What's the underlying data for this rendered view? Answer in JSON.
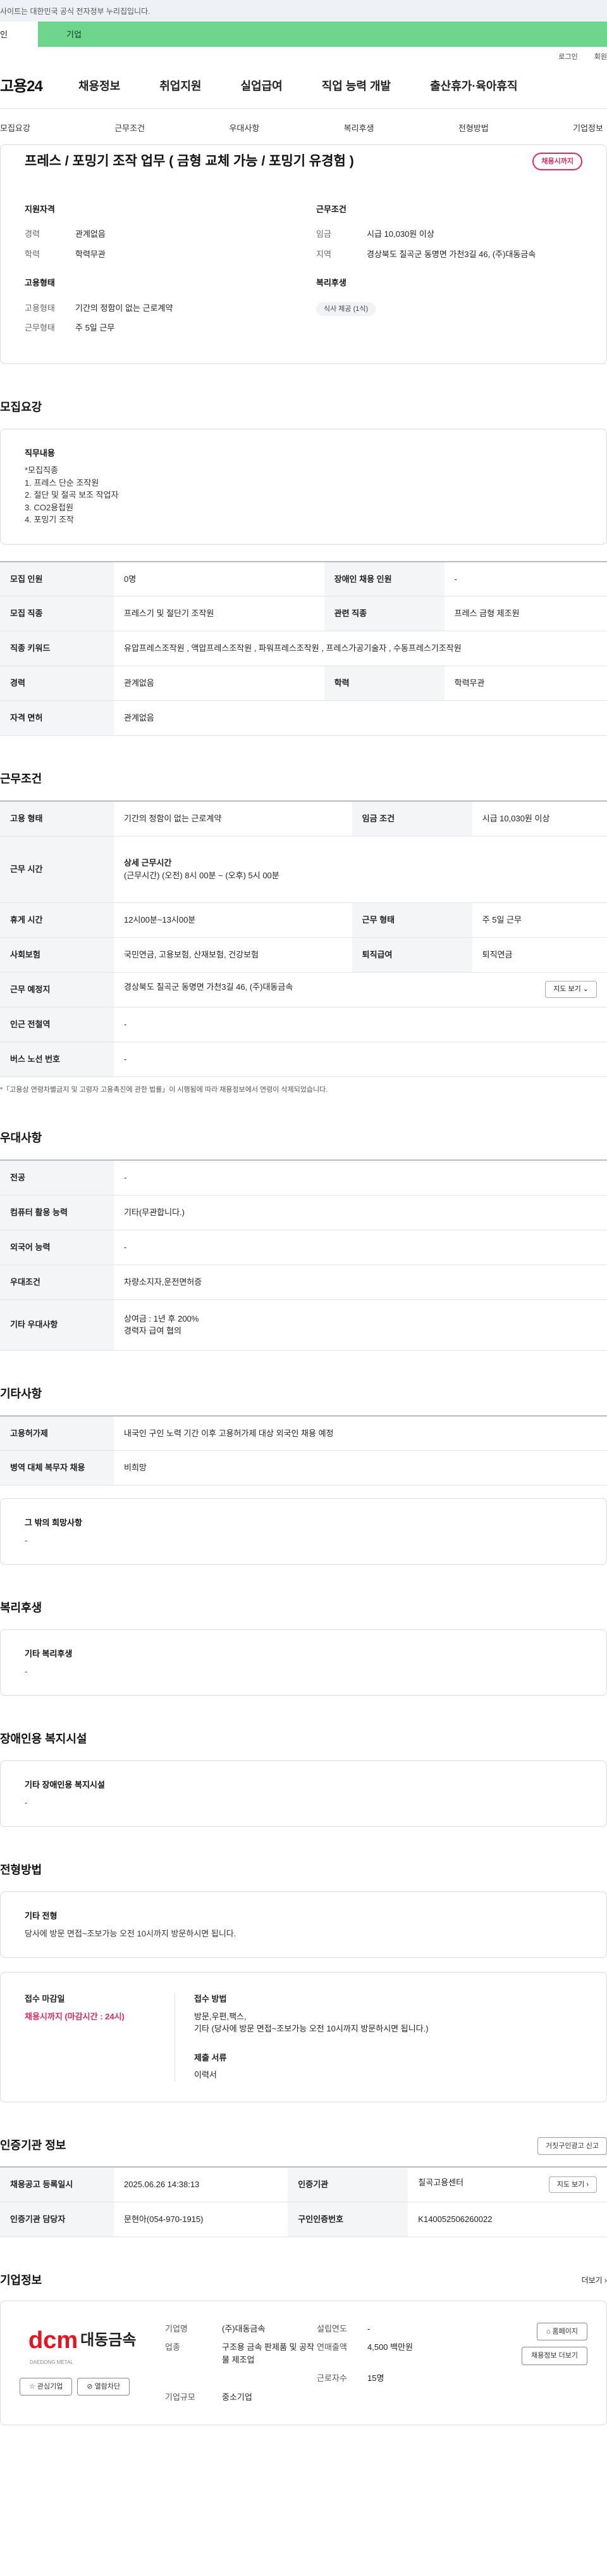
{
  "topbar": {
    "notice": "사이트는 대한민국 공식 전자정부 누리집입니다."
  },
  "tabs": {
    "tab1": "인",
    "tab2": "기업"
  },
  "util": {
    "login": "로그인",
    "join": "회원"
  },
  "gnb": {
    "logo": "고용24",
    "items": [
      "채용정보",
      "취업지원",
      "실업급여",
      "직업 능력 개발",
      "출산휴가·육아휴직"
    ]
  },
  "subnav": [
    "모집요강",
    "근무조건",
    "우대사항",
    "복리후생",
    "전형방법",
    "기업정보"
  ],
  "summary": {
    "title": "프레스 / 포밍기 조작 업무 ( 금형 교체 가능 / 포밍기 유경험 )",
    "badge": "채용시까지",
    "qual_title": "지원자격",
    "career_label": "경력",
    "career_value": "관계없음",
    "edu_label": "학력",
    "edu_value": "학력무관",
    "emp_title": "고용형태",
    "emptype_label": "고용형태",
    "emptype_value": "기간의 정함이 없는 근로계약",
    "worktype_label": "근무형태",
    "worktype_value": "주 5일 근무",
    "cond_title": "근무조건",
    "wage_label": "임금",
    "wage_value": "시급 10,030원 이상",
    "region_label": "지역",
    "region_value": "경상북도 칠곡군 동명면 가천3길 46, (주)대동금속",
    "welfare_title": "복리후생",
    "welfare_chip": "식사 제공 (1식)"
  },
  "recruit": {
    "title": "모집요강",
    "duty_title": "직무내용",
    "duty_text": "*모집직종\n1. 프레스 단순 조작원\n2. 절단 및 절곡 보조 작업자\n3. CO2용접원\n4. 포밍기 조작",
    "rows": {
      "count_label": "모집 인원",
      "count_value": "0명",
      "disabled_label": "장애인 채용 인원",
      "disabled_value": "-",
      "job_label": "모집 직종",
      "job_value": "프레스기 및 절단기 조작원",
      "related_label": "관련 직종",
      "related_value": "프레스 금형 제조원",
      "keyword_label": "직종 키워드",
      "keyword_value": "유압프레스조작원 , 액압프레스조작원 , 파워프레스조작원 , 프레스가공기술자 , 수동프레스기조작원",
      "career_label": "경력",
      "career_value": "관계없음",
      "edu_label": "학력",
      "edu_value": "학력무관",
      "license_label": "자격 면허",
      "license_value": "관계없음"
    }
  },
  "work": {
    "title": "근무조건",
    "emptype_label": "고용 형태",
    "emptype_value": "기간의 정함이 없는 근로계약",
    "wage_label": "임금 조건",
    "wage_value": "시급 10,030원 이상",
    "hours_label": "근무 시간",
    "hours_sub": "상세 근무시간",
    "hours_value": "(근무시간) (오전) 8시 00분 ~ (오후) 5시 00분",
    "break_label": "휴게 시간",
    "break_value": "12시00분~13시00분",
    "form_label": "근무 형태",
    "form_value": "주 5일 근무",
    "ins_label": "사회보험",
    "ins_value": "국민연금, 고용보험, 산재보험, 건강보험",
    "ret_label": "퇴직급여",
    "ret_value": "퇴직연금",
    "place_label": "근무 예정지",
    "place_value": "경상북도 칠곡군 동명면 가천3길 46, (주)대동금속",
    "map_btn": "지도 보기 ⌄",
    "subway_label": "인근 전철역",
    "subway_value": "-",
    "bus_label": "버스 노선 번호",
    "bus_value": "-",
    "note": "*「고용상 연령차별금지 및 고령자 고용촉진에 관한 법률」이 시행됨에 따라 채용정보에서 연령이 삭제되었습니다."
  },
  "pref": {
    "title": "우대사항",
    "major_label": "전공",
    "major_value": "-",
    "pc_label": "컴퓨터 활용 능력",
    "pc_value": "기타(무관합니다.)",
    "lang_label": "외국어 능력",
    "lang_value": "-",
    "cond_label": "우대조건",
    "cond_value": "차량소지자,운전면허증",
    "etc_label": "기타 우대사항",
    "etc_value": "상여금 : 1년 후 200%\n경력자 급여 협의"
  },
  "other": {
    "title": "기타사항",
    "permit_label": "고용허가제",
    "permit_value": "내국인 구인 노력 기간 이후 고용허가제 대상 외국인 채용 예정",
    "military_label": "병역 대체 복무자 채용",
    "military_value": "비희망",
    "hope_title": "그 밖의 희망사항",
    "hope_value": "-"
  },
  "welfare": {
    "title": "복리후생",
    "etc_title": "기타 복리후생",
    "etc_value": "-"
  },
  "disabled": {
    "title": "장애인용 복지시설",
    "etc_title": "기타 장애인용 복지시설",
    "etc_value": "-"
  },
  "selection": {
    "title": "전형방법",
    "etc_title": "기타 전형",
    "etc_value": "당사에 방문 면접~조보가능 오전 10시까지 방문하시면 됩니다.",
    "deadline_title": "접수 마감일",
    "deadline_value": "채용시까지 (마감시간 : 24시)",
    "method_title": "접수 방법",
    "method_value": "방문,우편,팩스,\n기타 (당사에 방문 면접~조보가능 오전 10시까지 방문하시면 됩니다.)",
    "docs_title": "제출 서류",
    "docs_value": "이력서"
  },
  "agency": {
    "title": "인증기관 정보",
    "report_btn": "거짓구인광고 신고",
    "reg_label": "채용공고 등록일시",
    "reg_value": "2025.06.26 14:38:13",
    "org_label": "인증기관",
    "org_value": "칠곡고용센터",
    "map_btn": "지도 보기 ›",
    "mgr_label": "인증기관 담당자",
    "mgr_value": "문현아(054-970-1915)",
    "no_label": "구인인증번호",
    "no_value": "K140052506260022"
  },
  "companyInfo": {
    "title": "기업정보",
    "more": "더보기 ›",
    "logo_en": "dcm",
    "logo_kr": "대동금속",
    "logo_tag": "DAEDONG METAL",
    "fav_btn": "☆ 관심기업",
    "block_btn": "⊘ 열람차단",
    "name_label": "기업명",
    "name_value": "(주)대동금속",
    "year_label": "설립연도",
    "year_value": "-",
    "biz_label": "업종",
    "biz_value": "구조용 금속 판제품 및 공작물 제조업",
    "sales_label": "연매출액",
    "sales_value": "4,500 백만원",
    "emp_label": "근로자수",
    "emp_value": "15명",
    "size_label": "기업규모",
    "size_value": "중소기업",
    "home_btn": "⌂ 홈페이지",
    "jobs_btn": "채용정보 더보기"
  },
  "colors": {
    "accent_green": "#6dd58c",
    "accent_red": "#e4285c",
    "brand_red": "#e4151f"
  }
}
